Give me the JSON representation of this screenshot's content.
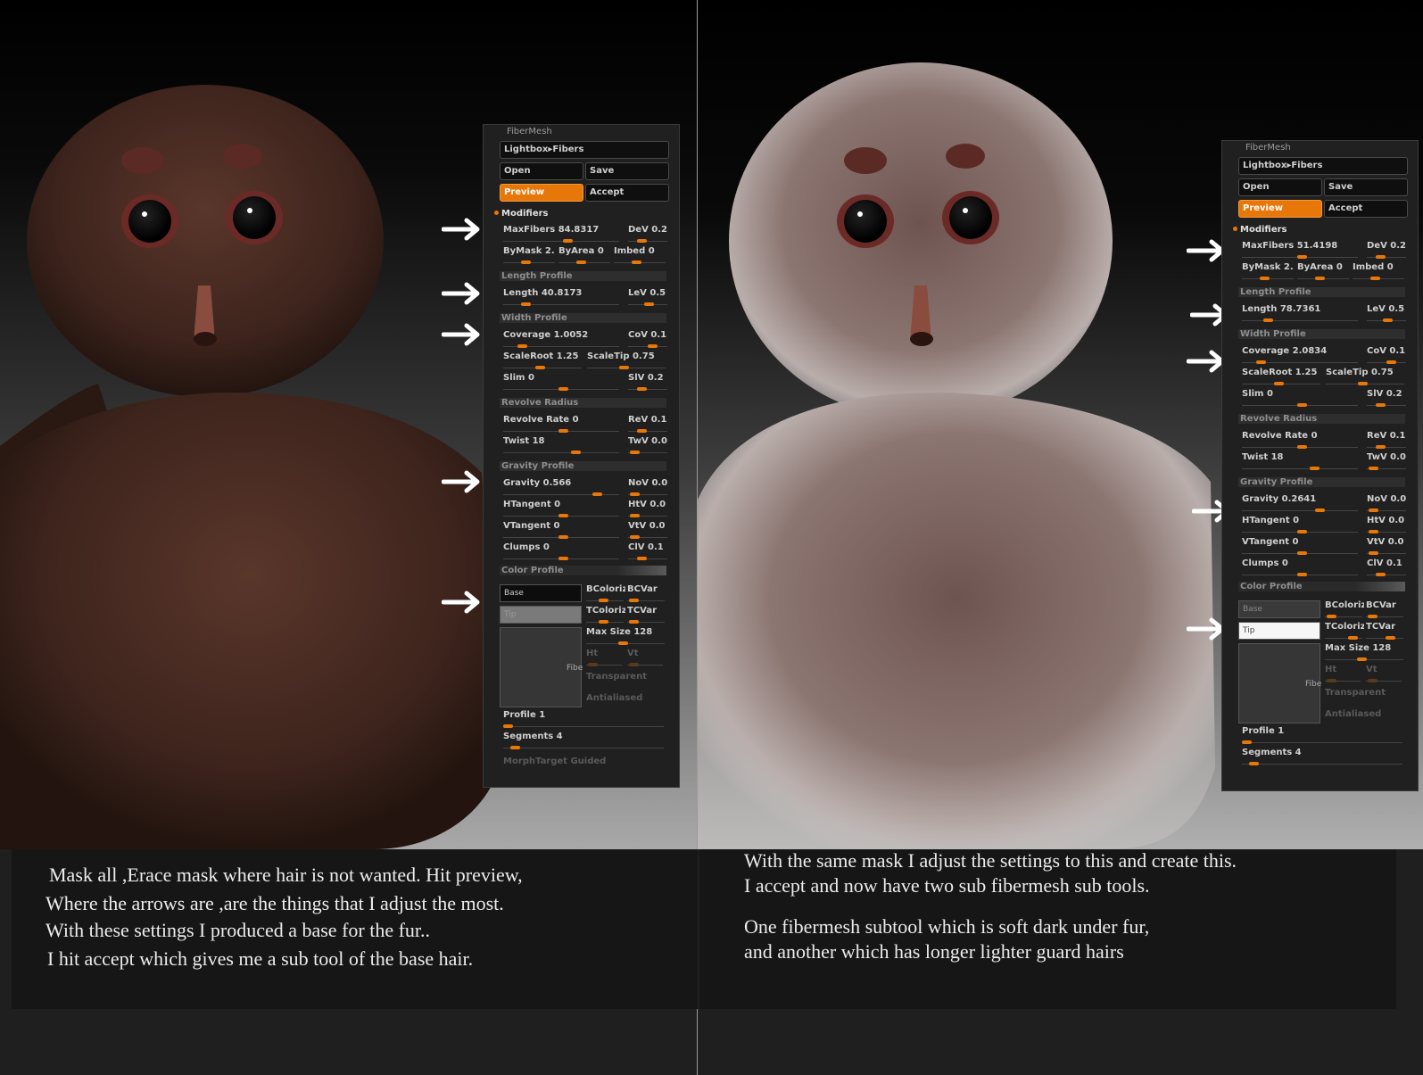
{
  "left_panel": {
    "title": "FiberMesh",
    "lightbox": "Lightbox▸Fibers",
    "open": "Open",
    "save": "Save",
    "preview": "Preview",
    "accept": "Accept",
    "modifiers": "Modifiers",
    "maxfibers": "MaxFibers 84.8317",
    "dev": "DeV 0.2",
    "bymask": "ByMask 2.",
    "byarea": "ByArea 0",
    "imbed": "Imbed 0",
    "length_profile": "Length Profile",
    "length": "Length 40.8173",
    "lev": "LeV 0.5",
    "width_profile": "Width Profile",
    "coverage": "Coverage 1.0052",
    "cov": "CoV 0.1",
    "scaleroot": "ScaleRoot 1.25",
    "scaletip": "ScaleTip 0.75",
    "slim": "Slim 0",
    "slv": "SlV 0.2",
    "revolve_radius": "Revolve Radius",
    "revolve_rate": "Revolve Rate 0",
    "rev": "ReV 0.1",
    "twist": "Twist 18",
    "twv": "TwV 0.0",
    "gravity_profile": "Gravity Profile",
    "gravity": "Gravity 0.566",
    "nov": "NoV 0.0",
    "htangent": "HTangent 0",
    "htv": "HtV 0.0",
    "vtangent": "VTangent 0",
    "vtv": "VtV 0.0",
    "clumps": "Clumps 0",
    "clv": "ClV 0.1",
    "color_profile": "Color Profile",
    "base": "Base",
    "tip": "Tip",
    "bcolorize": "BColoriz",
    "bcvar": "BCVar",
    "tcolorize": "TColoriz",
    "tcvar": "TCVar",
    "max_size": "Max Size 128",
    "ht": "Ht",
    "vt": "Vt",
    "fibe": "Fibe",
    "transparent": "Transparent",
    "antialiased": "Antialiased",
    "profile": "Profile 1",
    "segments": "Segments 4",
    "morph": "MorphTarget Guided"
  },
  "right_panel": {
    "title": "FiberMesh",
    "lightbox": "Lightbox▸Fibers",
    "open": "Open",
    "save": "Save",
    "preview": "Preview",
    "accept": "Accept",
    "modifiers": "Modifiers",
    "maxfibers": "MaxFibers 51.4198",
    "dev": "DeV 0.2",
    "bymask": "ByMask 2.",
    "byarea": "ByArea 0",
    "imbed": "Imbed 0",
    "length_profile": "Length Profile",
    "length": "Length 78.7361",
    "lev": "LeV 0.5",
    "width_profile": "Width Profile",
    "coverage": "Coverage 2.0834",
    "cov": "CoV 0.1",
    "scaleroot": "ScaleRoot 1.25",
    "scaletip": "ScaleTip 0.75",
    "slim": "Slim 0",
    "slv": "SlV 0.2",
    "revolve_radius": "Revolve Radius",
    "revolve_rate": "Revolve Rate 0",
    "rev": "ReV 0.1",
    "twist": "Twist 18",
    "twv": "TwV 0.0",
    "gravity_profile": "Gravity Profile",
    "gravity": "Gravity 0.2641",
    "nov": "NoV 0.0",
    "htangent": "HTangent 0",
    "htv": "HtV 0.0",
    "vtangent": "VTangent 0",
    "vtv": "VtV 0.0",
    "clumps": "Clumps 0",
    "clv": "ClV 0.1",
    "color_profile": "Color Profile",
    "base": "Base",
    "tip": "Tip",
    "bcolorize": "BColoriz",
    "bcvar": "BCVar",
    "tcolorize": "TColoriz",
    "tcvar": "TCVar",
    "max_size": "Max Size 128",
    "ht": "Ht",
    "vt": "Vt",
    "fibe": "Fibe",
    "transparent": "Transparent",
    "antialiased": "Antialiased",
    "profile": "Profile 1",
    "segments": "Segments 4"
  },
  "captions": {
    "left": [
      "Mask all ,Erace mask where hair is not wanted. Hit preview,",
      "Where the arrows are ,are the things that I adjust the most.",
      "With these settings I produced a base for the fur..",
      "I hit accept which gives me a sub tool of the base hair."
    ],
    "right": [
      "With the same mask I adjust the settings to this and create this.",
      "I accept and now have two sub fibermesh sub tools.",
      "One fibermesh subtool which is soft dark under fur,",
      "and another which has longer lighter guard hairs"
    ]
  },
  "colors": {
    "accent": "#e8770a",
    "panel_bg": "#202020",
    "left_fur": "#4a2c24",
    "right_fur": "#8a7470"
  }
}
